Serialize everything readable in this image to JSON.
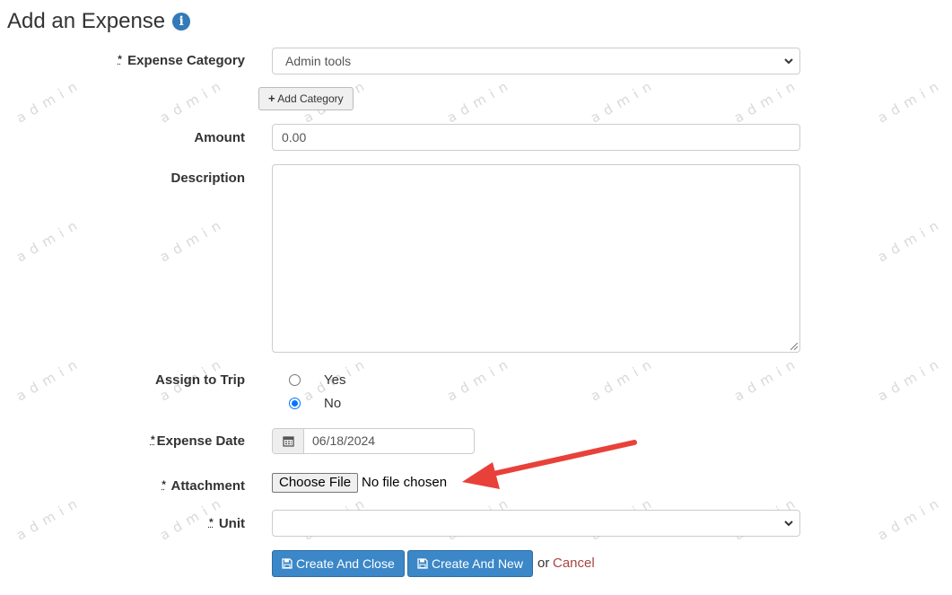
{
  "page": {
    "title": "Add an Expense",
    "watermark": "admin"
  },
  "icons": {
    "info": "info-icon",
    "plus": "plus-icon",
    "calendar": "calendar-icon",
    "save": "save-icon",
    "chevron": "chevron-down-icon"
  },
  "colors": {
    "primary": "#3b87c8",
    "cancel": "#a94442",
    "arrow": "#e8413a",
    "radio": "#0075ff"
  },
  "form": {
    "required_marker": "*",
    "expense_category": {
      "label": "Expense Category",
      "value": "Admin tools"
    },
    "add_category_label": "Add Category",
    "amount": {
      "label": "Amount",
      "value": "0.00"
    },
    "description": {
      "label": "Description",
      "value": ""
    },
    "assign_to_trip": {
      "label": "Assign to Trip",
      "options": [
        "Yes",
        "No"
      ],
      "selected": "No"
    },
    "expense_date": {
      "label": "Expense Date",
      "value": "06/18/2024"
    },
    "attachment": {
      "label": "Attachment",
      "button": "Choose File",
      "status": "No file chosen"
    },
    "unit": {
      "label": "Unit",
      "value": ""
    },
    "actions": {
      "create_close": "Create And Close",
      "create_new": "Create And New",
      "or": "or",
      "cancel": "Cancel"
    }
  }
}
